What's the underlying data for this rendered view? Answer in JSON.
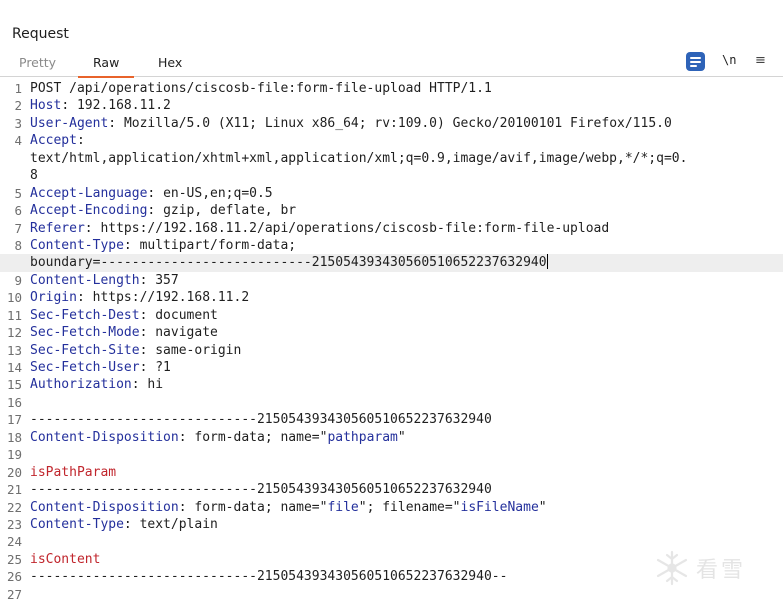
{
  "panel": {
    "title": "Request"
  },
  "tabs": [
    {
      "label": "Pretty",
      "active": false
    },
    {
      "label": "Raw",
      "active": true
    },
    {
      "label": "Hex",
      "active": false
    }
  ],
  "toolbar": {
    "wrap_icon": "word-wrap-icon",
    "newline_label": "\\n",
    "menu_icon": "hamburger-menu-icon",
    "accent_color": "#2e63b8",
    "active_tab_color": "#e8632b"
  },
  "boundary": "----------------------------2150543934305605106522376329 40",
  "lines": [
    {
      "num": "1",
      "key": "",
      "sep": "",
      "text": "POST /api/operations/ciscosb-file:form-file-upload HTTP/1.1"
    },
    {
      "num": "2",
      "key": "Host",
      "sep": ": ",
      "text": "192.168.11.2"
    },
    {
      "num": "3",
      "key": "User-Agent",
      "sep": ": ",
      "text": "Mozilla/5.0 (X11; Linux x86_64; rv:109.0) Gecko/20100101 Firefox/115.0"
    },
    {
      "num": "4",
      "key": "Accept",
      "sep": ":",
      "text": ""
    },
    {
      "num": "",
      "key": "",
      "sep": "",
      "text": "text/html,application/xhtml+xml,application/xml;q=0.9,image/avif,image/webp,*/*;q=0."
    },
    {
      "num": "",
      "key": "",
      "sep": "",
      "text": "8"
    },
    {
      "num": "5",
      "key": "Accept-Language",
      "sep": ": ",
      "text": "en-US,en;q=0.5"
    },
    {
      "num": "6",
      "key": "Accept-Encoding",
      "sep": ": ",
      "text": "gzip, deflate, br"
    },
    {
      "num": "7",
      "key": "Referer",
      "sep": ": ",
      "text": "https://192.168.11.2/api/operations/ciscosb-file:form-file-upload"
    },
    {
      "num": "8",
      "key": "Content-Type",
      "sep": ": ",
      "text": "multipart/form-data;"
    },
    {
      "num": "",
      "key": "",
      "sep": "",
      "text": "boundary=---------------------------215054393430560510652237632940",
      "current": true
    },
    {
      "num": "9",
      "key": "Content-Length",
      "sep": ": ",
      "text": "357"
    },
    {
      "num": "10",
      "key": "Origin",
      "sep": ": ",
      "text": "https://192.168.11.2"
    },
    {
      "num": "11",
      "key": "Sec-Fetch-Dest",
      "sep": ": ",
      "text": "document"
    },
    {
      "num": "12",
      "key": "Sec-Fetch-Mode",
      "sep": ": ",
      "text": "navigate"
    },
    {
      "num": "13",
      "key": "Sec-Fetch-Site",
      "sep": ": ",
      "text": "same-origin"
    },
    {
      "num": "14",
      "key": "Sec-Fetch-User",
      "sep": ": ",
      "text": "?1"
    },
    {
      "num": "15",
      "key": "Authorization",
      "sep": ": ",
      "text": "hi"
    },
    {
      "num": "16",
      "key": "",
      "sep": "",
      "text": ""
    },
    {
      "num": "17",
      "key": "",
      "sep": "",
      "text": "-----------------------------215054393430560510652237632940"
    },
    {
      "num": "18",
      "key": "Content-Disposition",
      "sep": ": ",
      "text": "form-data; name=\"",
      "q1": "pathparam",
      "tail1": "\""
    },
    {
      "num": "19",
      "key": "",
      "sep": "",
      "text": ""
    },
    {
      "num": "20",
      "key": "",
      "sep": "",
      "text": "",
      "red": "isPathParam"
    },
    {
      "num": "21",
      "key": "",
      "sep": "",
      "text": "-----------------------------215054393430560510652237632940"
    },
    {
      "num": "22",
      "key": "Content-Disposition",
      "sep": ": ",
      "text": "form-data; name=\"",
      "q1": "file",
      "tail1": "\"; filename=\"",
      "q2": "isFileName",
      "tail2": "\""
    },
    {
      "num": "23",
      "key": "Content-Type",
      "sep": ": ",
      "text": "text/plain"
    },
    {
      "num": "24",
      "key": "",
      "sep": "",
      "text": ""
    },
    {
      "num": "25",
      "key": "",
      "sep": "",
      "text": "",
      "red": "isContent"
    },
    {
      "num": "26",
      "key": "",
      "sep": "",
      "text": "-----------------------------215054393430560510652237632940--"
    },
    {
      "num": "27",
      "key": "",
      "sep": "",
      "text": ""
    }
  ],
  "watermark": {
    "text": "看雪",
    "icon": "snowflake-watermark-icon"
  }
}
